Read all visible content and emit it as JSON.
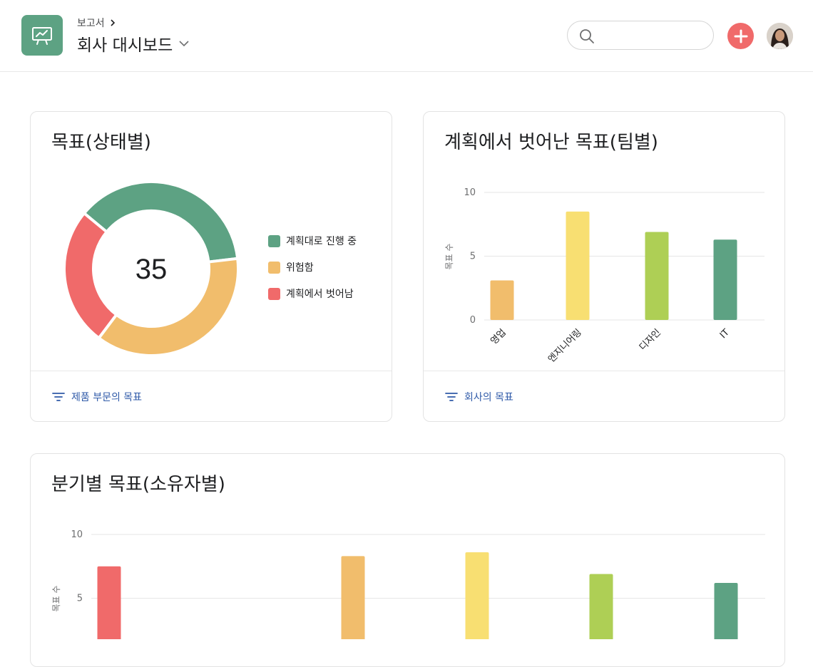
{
  "header": {
    "breadcrumb": "보고서",
    "title": "회사 대시보드",
    "search": {
      "placeholder": "",
      "value": ""
    },
    "icons": [
      "presentation-chart-icon",
      "chevron-right-icon",
      "chevron-down-icon",
      "search-icon",
      "plus-icon",
      "avatar"
    ]
  },
  "colors": {
    "on_track": "#5da283",
    "at_risk": "#f1bd6c",
    "off_track": "#f06a6a",
    "yellow": "#f8df72",
    "lime": "#aecf55",
    "orange": "#ec8d71",
    "link": "#2f5aa8"
  },
  "card1": {
    "title": "목표(상태별)",
    "center_value": "35",
    "footer_link": "제품 부문의 목표"
  },
  "card2": {
    "title": "계획에서 벗어난 목표(팀별)",
    "footer_link": "회사의 목표"
  },
  "card3": {
    "title": "분기별 목표(소유자별)"
  },
  "chart_data": [
    {
      "type": "pie",
      "title": "목표(상태별)",
      "total": 35,
      "slices": [
        {
          "label": "계획대로 진행 중",
          "value": 13,
          "color": "#5da283"
        },
        {
          "label": "위험함",
          "value": 13,
          "color": "#f1bd6c"
        },
        {
          "label": "계획에서 벗어남",
          "value": 9,
          "color": "#f06a6a"
        }
      ],
      "legend": "right"
    },
    {
      "type": "bar",
      "title": "계획에서 벗어난 목표(팀별)",
      "ylabel": "목표 수",
      "ylim": [
        0,
        10
      ],
      "yticks": [
        "0",
        "5",
        "10"
      ],
      "categories": [
        "영업",
        "엔지니어링",
        "디자인",
        "IT"
      ],
      "values": [
        3.1,
        8.5,
        6.9,
        6.3
      ],
      "colors": [
        "#f1bd6c",
        "#f8df72",
        "#aecf55",
        "#5da283"
      ],
      "grid": true
    },
    {
      "type": "bar",
      "title": "분기별 목표(소유자별)",
      "ylabel": "목표 수",
      "ylim": [
        0,
        10
      ],
      "yticks": [
        "5",
        "10"
      ],
      "values": [
        7.5,
        0.3,
        8.3,
        8.6,
        6.9,
        6.2
      ],
      "colors": [
        "#f06a6a",
        "#ec8d71",
        "#f1bd6c",
        "#f8df72",
        "#aecf55",
        "#5da283"
      ],
      "grid": true
    }
  ]
}
